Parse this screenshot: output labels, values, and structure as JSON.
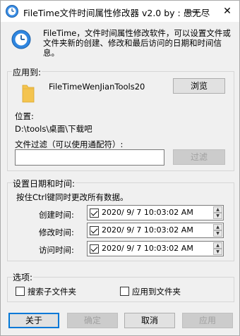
{
  "window": {
    "title": "FileTime文件时间属性修改器 v2.0    by : 愚无尽",
    "minimize_glyph": "—",
    "close_glyph": "✕"
  },
  "header": {
    "description": "FileTime，文件时间属性修改软件，可以设置文件或文件夹新的创建、修改和最后访问的日期和时间信息。"
  },
  "apply_to": {
    "group_label": "应用到:",
    "file_name": "FileTimeWenJianTools20",
    "browse_label": "浏览",
    "location_label": "位置:",
    "location_path": "D:\\tools\\桌面\\下载吧",
    "filter_label": "文件过滤（可以使用通配符）:",
    "filter_value": "",
    "filter_button": "过滤"
  },
  "datetime": {
    "group_label": "设置日期和时间:",
    "hint": "按住Ctrl键同时更改所有数据。",
    "rows": [
      {
        "label": "创建时间:",
        "value": "2020/ 9/ 7   10:03:02 AM",
        "checked": true
      },
      {
        "label": "修改时间:",
        "value": "2020/ 9/ 7   10:03:02 AM",
        "checked": true
      },
      {
        "label": "访问时间:",
        "value": "2020/ 9/ 7   10:03:02 AM",
        "checked": true
      }
    ]
  },
  "options": {
    "group_label": "选项:",
    "search_subfolders": "搜索子文件夹",
    "apply_to_folders": "应用到文件夹"
  },
  "footer": {
    "about": "关于",
    "ok": "确定",
    "cancel": "取消",
    "apply": "应用"
  },
  "colors": {
    "accent": "#0078d7",
    "folder": "#f4c44f",
    "disabled_text": "#a0a0a0"
  }
}
